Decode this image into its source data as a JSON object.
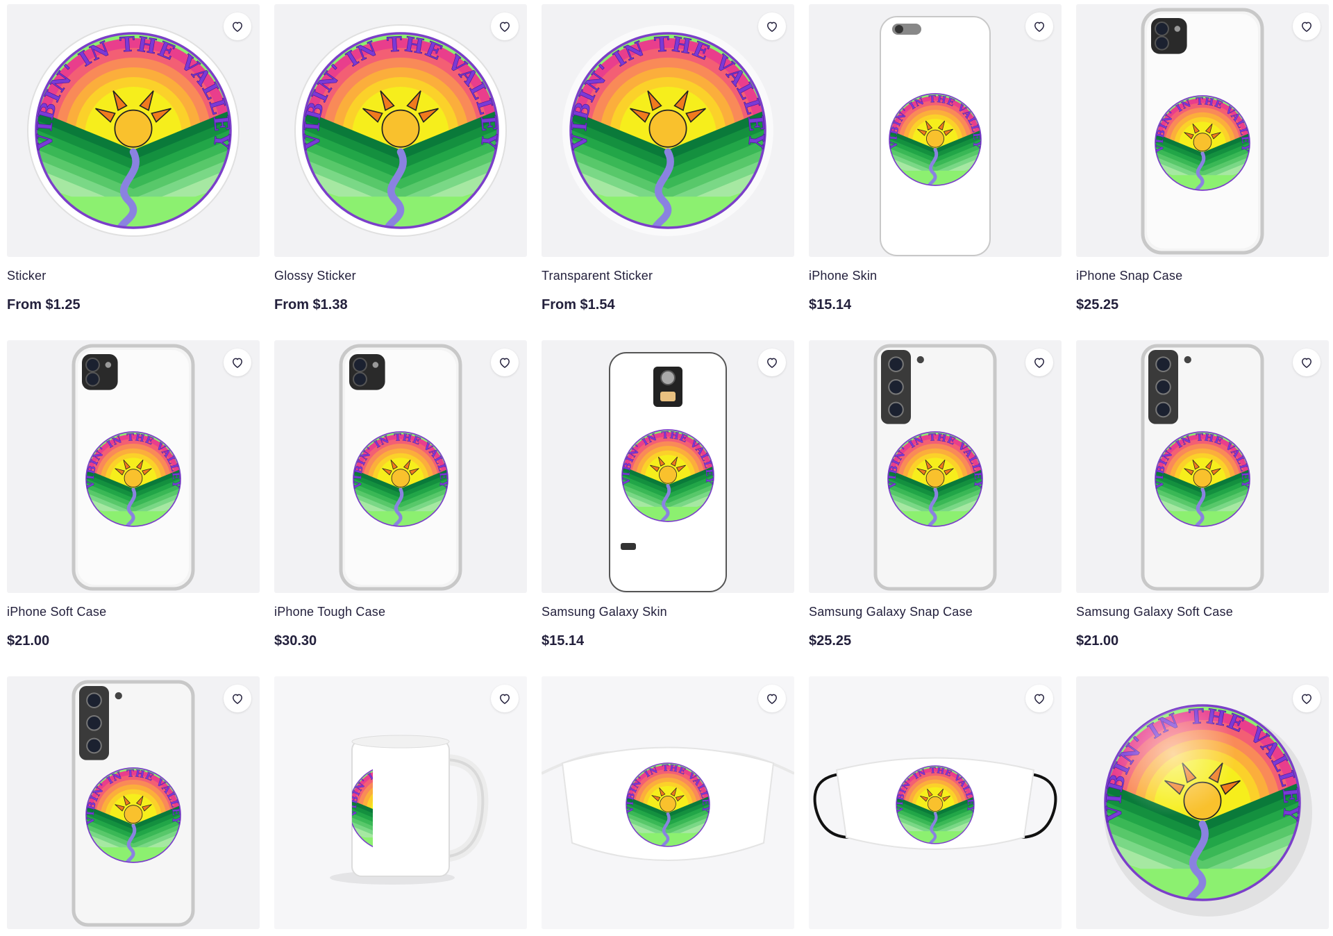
{
  "colors": {
    "text": "#23203c",
    "tile_background": "#f2f2f4",
    "logo_outline": "#7b3fc9",
    "logo_text": "#7a3ad6"
  },
  "logo_text": "VIBIN' IN THE VALLEY",
  "products": [
    {
      "title": "Sticker",
      "price": "From $1.25",
      "image": "sticker",
      "icon": "heart-icon"
    },
    {
      "title": "Glossy Sticker",
      "price": "From $1.38",
      "image": "sticker",
      "icon": "heart-icon"
    },
    {
      "title": "Transparent Sticker",
      "price": "From $1.54",
      "image": "sticker-transparent",
      "icon": "heart-icon"
    },
    {
      "title": "iPhone Skin",
      "price": "$15.14",
      "image": "iphone-skin",
      "icon": "heart-icon"
    },
    {
      "title": "iPhone Snap Case",
      "price": "$25.25",
      "image": "iphone-case",
      "icon": "heart-icon"
    },
    {
      "title": "iPhone Soft Case",
      "price": "$21.00",
      "image": "iphone-case",
      "icon": "heart-icon"
    },
    {
      "title": "iPhone Tough Case",
      "price": "$30.30",
      "image": "iphone-case",
      "icon": "heart-icon"
    },
    {
      "title": "Samsung Galaxy Skin",
      "price": "$15.14",
      "image": "samsung-skin",
      "icon": "heart-icon"
    },
    {
      "title": "Samsung Galaxy Snap Case",
      "price": "$25.25",
      "image": "samsung-case",
      "icon": "heart-icon"
    },
    {
      "title": "Samsung Galaxy Soft Case",
      "price": "$21.00",
      "image": "samsung-case",
      "icon": "heart-icon"
    },
    {
      "title": "",
      "price": "",
      "image": "samsung-case",
      "icon": "heart-icon"
    },
    {
      "title": "",
      "price": "",
      "image": "mug",
      "icon": "heart-icon"
    },
    {
      "title": "",
      "price": "",
      "image": "mask-flat",
      "icon": "heart-icon"
    },
    {
      "title": "",
      "price": "",
      "image": "mask-worn",
      "icon": "heart-icon"
    },
    {
      "title": "",
      "price": "",
      "image": "pin-button",
      "icon": "heart-icon"
    }
  ]
}
